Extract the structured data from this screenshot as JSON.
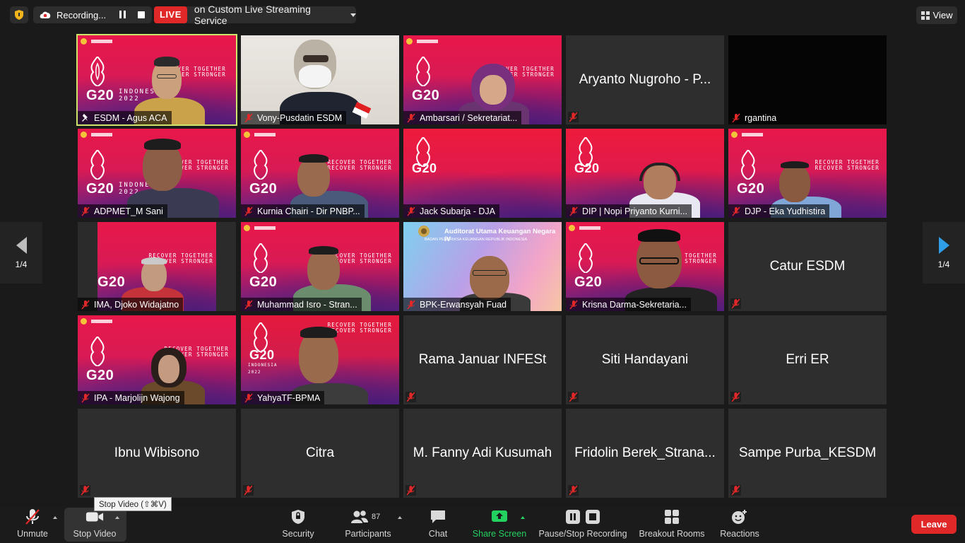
{
  "topbar": {
    "recording_label": "Recording...",
    "live_badge": "LIVE",
    "live_service": "on Custom Live Streaming Service",
    "view_label": "View"
  },
  "tiles_video": [
    {
      "name": "ESDM - Agus ACA"
    },
    {
      "name": "Vony-Pusdatin ESDM"
    },
    {
      "name": "Ambarsari / Sekretariat..."
    },
    {
      "name": "ADPMET_M Sani"
    },
    {
      "name": "Kurnia Chairi - Dir PNBP..."
    },
    {
      "name": "Jack Subarja - DJA"
    },
    {
      "name": "DIP | Nopi Priyanto Kurni..."
    },
    {
      "name": "DJP - Eka Yudhistira"
    },
    {
      "name": "IMA, Djoko Widajatno"
    },
    {
      "name": "Muhammad Isro - Stran..."
    },
    {
      "name": "BPK-Erwansyah Fuad"
    },
    {
      "name": "Krisna Darma-Sekretaria..."
    },
    {
      "name": "IPA - Marjolijn Wajong"
    },
    {
      "name": "YahyaTF-BPMA"
    }
  ],
  "tiles_noVideo": [
    {
      "name": "Aryanto Nugroho - P..."
    },
    {
      "name": "Catur ESDM"
    },
    {
      "name": "Rama Januar INFESt"
    },
    {
      "name": "Siti Handayani"
    },
    {
      "name": "Erri ER"
    },
    {
      "name": "Ibnu Wibisono"
    },
    {
      "name": "Citra"
    },
    {
      "name": "M. Fanny Adi Kusumah"
    },
    {
      "name": "Fridolin Berek_Strana..."
    },
    {
      "name": "Sampe Purba_KESDM"
    }
  ],
  "tile_rgantina": {
    "name": "rgantina"
  },
  "g20": {
    "brand": "G20",
    "country": "INDONESIA",
    "year": "2022",
    "slogan_line1": "RECOVER TOGETHER",
    "slogan_line2": "RECOVER STRONGER",
    "indonesia_long": "INDONESIA"
  },
  "bpk": {
    "title": "Auditorat Utama Keuangan Negara IV",
    "subtitle": "BADAN PEMERIKSA KEUANGAN REPUBLIK INDONESIA"
  },
  "pager": {
    "left": "1/4",
    "right": "1/4"
  },
  "toolbar": {
    "unmute": "Unmute",
    "stop_video": "Stop Video",
    "security": "Security",
    "participants": "Participants",
    "participants_count": "87",
    "chat": "Chat",
    "share_screen": "Share Screen",
    "pause_stop_recording": "Pause/Stop Recording",
    "breakout_rooms": "Breakout Rooms",
    "reactions": "Reactions",
    "leave": "Leave",
    "tooltip": "Stop Video (⇧⌘V)"
  },
  "colors": {
    "live_red": "#e02828",
    "active_speaker_border": "#cde56a",
    "share_green": "#23d160",
    "pager_blue": "#2f9ee9"
  }
}
